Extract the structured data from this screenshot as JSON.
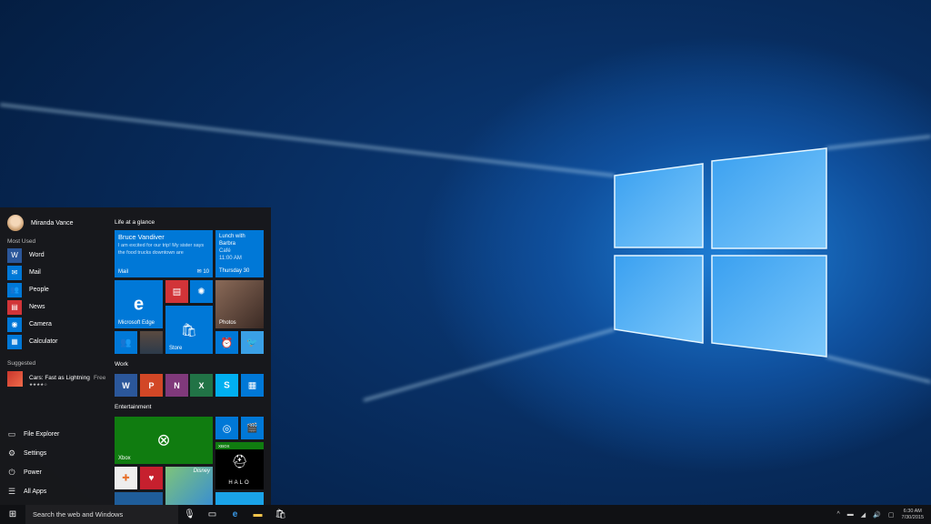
{
  "colors": {
    "accent": "#0078d7",
    "news": "#d13438",
    "word": "#2b579a",
    "powerpoint": "#d24726",
    "onenote": "#80397b",
    "excel": "#217346",
    "skype": "#00aff0",
    "xbox": "#107c10"
  },
  "user": {
    "name": "Miranda Vance"
  },
  "most_used": {
    "heading": "Most Used",
    "items": [
      {
        "label": "Word",
        "icon": "word-icon",
        "glyph": "W"
      },
      {
        "label": "Mail",
        "icon": "mail-icon",
        "glyph": "✉"
      },
      {
        "label": "People",
        "icon": "people-icon",
        "glyph": "👥"
      },
      {
        "label": "News",
        "icon": "news-icon",
        "glyph": "▤"
      },
      {
        "label": "Camera",
        "icon": "camera-icon",
        "glyph": "◉"
      },
      {
        "label": "Calculator",
        "icon": "calculator-icon",
        "glyph": "▦"
      }
    ]
  },
  "suggested": {
    "heading": "Suggested",
    "app": "Cars: Fast as Lightning",
    "price": "Free",
    "rating": "★★★★☆"
  },
  "bottom": [
    {
      "label": "File Explorer",
      "glyph": "▭"
    },
    {
      "label": "Settings",
      "glyph": "⚙"
    },
    {
      "label": "Power",
      "glyph": "⏻"
    },
    {
      "label": "All Apps",
      "glyph": "☰"
    }
  ],
  "groups": {
    "life": "Life at a glance",
    "work": "Work",
    "entertainment": "Entertainment"
  },
  "tiles": {
    "mail": {
      "from": "Bruce Vandiver",
      "body": "I am excited for our trip! My sister says the food trucks downtown are",
      "label": "Mail",
      "count": "10"
    },
    "calendar": {
      "event": "Lunch with Barbra",
      "place": "Café",
      "time": "11:00 AM",
      "day": "Thursday 30"
    },
    "edge": "Microsoft Edge",
    "photos": "Photos",
    "store": "Store",
    "xbox": "Xbox",
    "xbox_badge": "XBOX",
    "halo": "HALO",
    "disney": "Disney"
  },
  "taskbar": {
    "search_placeholder": "Search the web and Windows",
    "time": "6:30 AM",
    "date": "7/30/2015"
  }
}
